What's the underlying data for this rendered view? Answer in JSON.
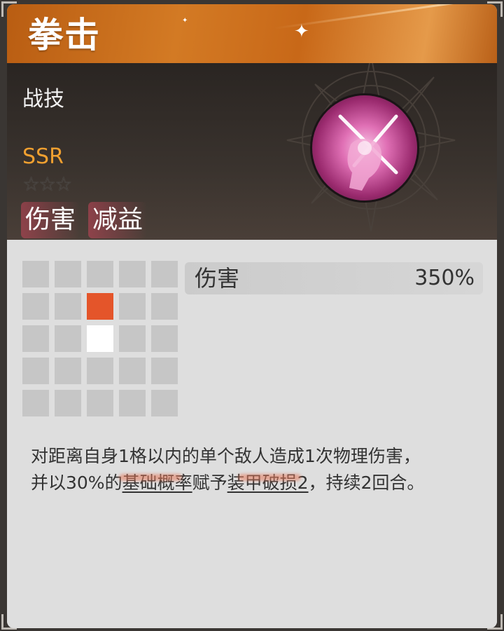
{
  "skill": {
    "name": "拳击",
    "type": "战技",
    "rarity": "SSR",
    "stars_filled": 0,
    "stars_total": 3,
    "tags": [
      "伤害",
      "减益"
    ],
    "icon": "fist-skill-icon"
  },
  "stat": {
    "label": "伤害",
    "value": "350%"
  },
  "range_grid": {
    "rows": 5,
    "cols": 5,
    "self": [
      2,
      2
    ],
    "targets": [
      [
        1,
        2
      ]
    ]
  },
  "description": {
    "line1": "对距离自身1格以内的单个敌人造成1次物理伤害，",
    "line2_a": "并以30%的",
    "line2_link1": "基础概率",
    "line2_b": "赋予",
    "line2_link2": "装甲破损2",
    "line2_c": "，持续2回合。"
  },
  "colors": {
    "title_bar": "#c86818",
    "rarity": "#f0a030",
    "target_cell": "#e4552a",
    "self_cell": "#ffffff",
    "empty_cell": "#c6c6c6"
  }
}
